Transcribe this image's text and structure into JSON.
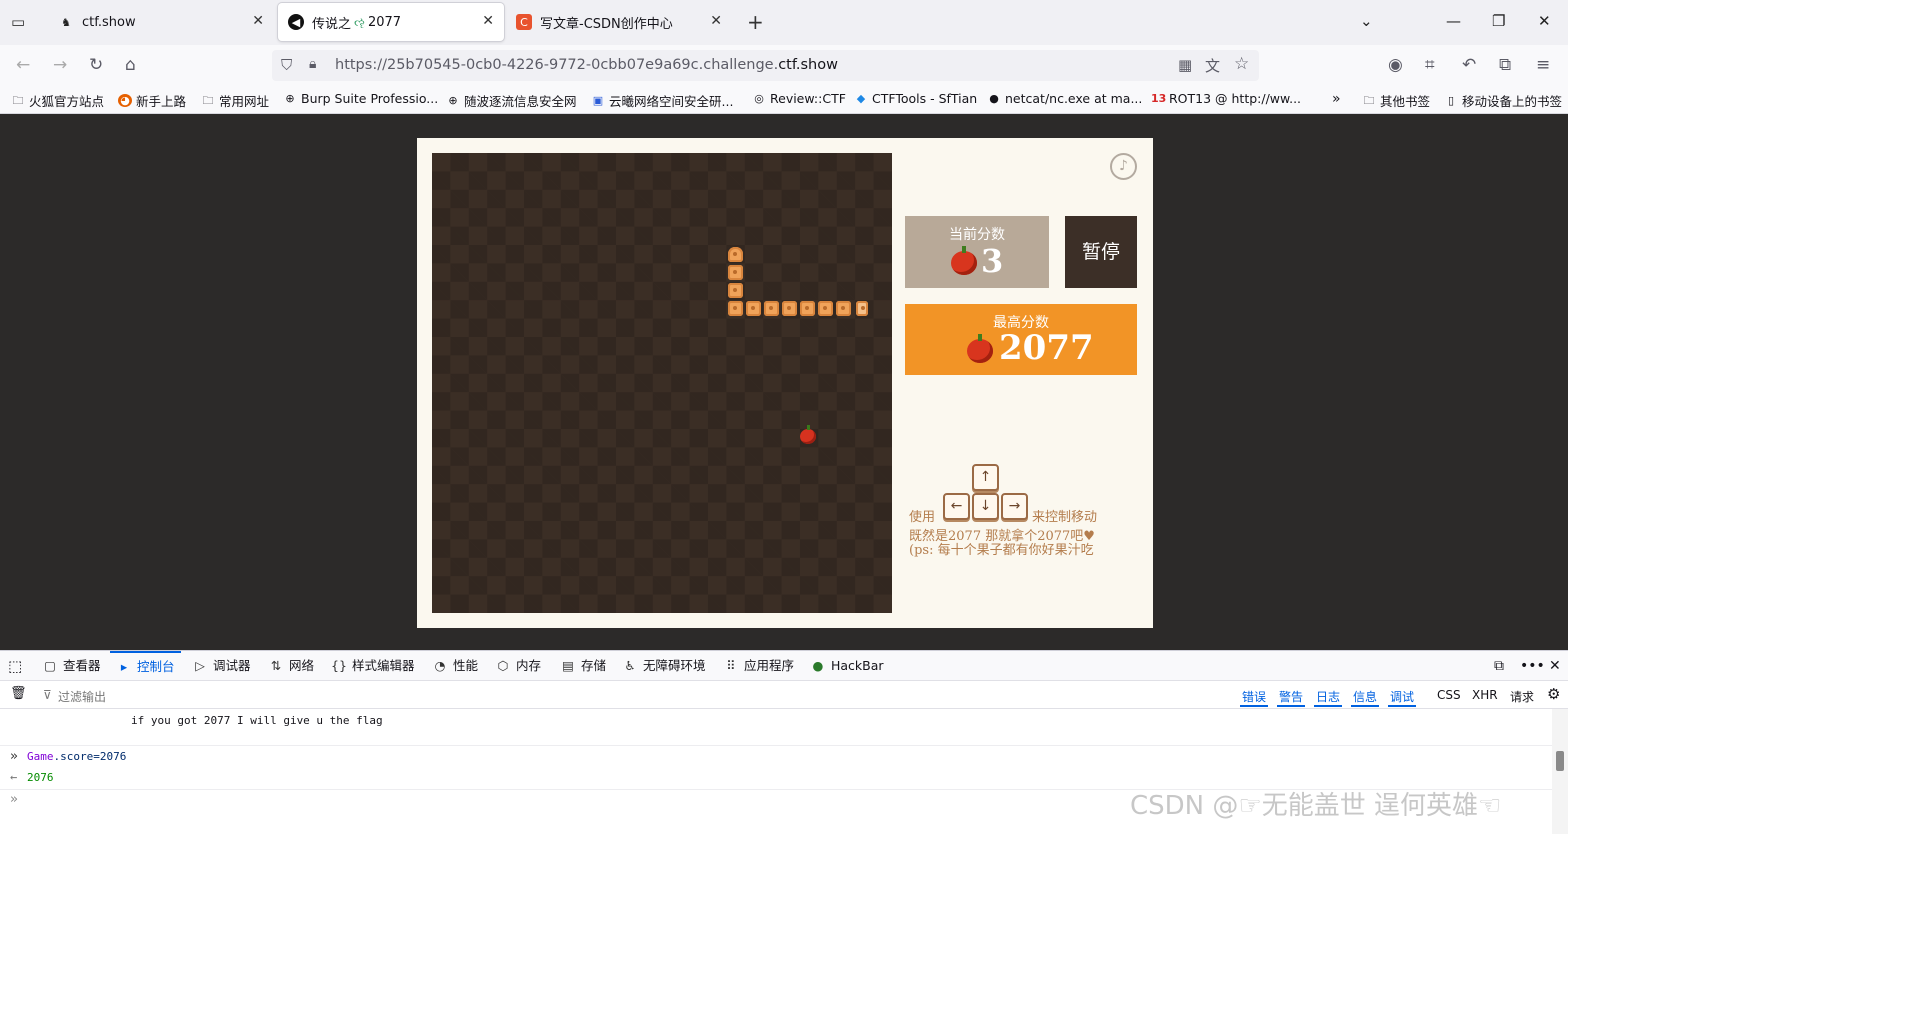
{
  "browser": {
    "tabs": [
      {
        "title": "ctf.show",
        "icon": "ctfshow-icon"
      },
      {
        "title": "传说之",
        "title_suffix": "2077",
        "icon": "audio-playing-icon"
      },
      {
        "title": "写文章-CSDN创作中心",
        "icon": "csdn-icon"
      }
    ],
    "url_prefix": "https://25b70545-0cb0-4226-9772-0cbb07e9a69c.challenge.",
    "url_domain": "ctf.show",
    "bookmarks": [
      "火狐官方站点",
      "新手上路",
      "常用网址",
      "Burp Suite Professio...",
      "随波逐流信息安全网",
      "云曦网络空间安全研...",
      "Review::CTF",
      "CTFTools - SfTian",
      "netcat/nc.exe at ma...",
      "ROT13 @ http://ww..."
    ],
    "bookmarks_right": [
      "其他书签",
      "移动设备上的书签"
    ]
  },
  "game": {
    "current_label": "当前分数",
    "current_score": "3",
    "pause_label": "暂停",
    "best_label": "最高分数",
    "best_score": "2077",
    "help_use": "使用",
    "help_move": "来控制移动",
    "help_line2": "既然是2077 那就拿个2077吧♥",
    "help_line3": "(ps: 每十个果子都有你好果汁吃",
    "keys": {
      "up": "↑",
      "left": "←",
      "down": "↓",
      "right": "→"
    }
  },
  "devtools": {
    "tabs": [
      "查看器",
      "控制台",
      "调试器",
      "网络",
      "样式编辑器",
      "性能",
      "内存",
      "存储",
      "无障碍环境",
      "应用程序",
      "HackBar"
    ],
    "active_tab": "控制台",
    "filter_placeholder": "过滤输出",
    "levels": [
      "错误",
      "警告",
      "日志",
      "信息",
      "调试"
    ],
    "extra_filters": [
      "CSS",
      "XHR",
      "请求"
    ],
    "console": {
      "log_line": "if you got 2077 I will give u the flag",
      "input_obj": "Game",
      "input_rest": ".score=2076",
      "result": "2076"
    }
  },
  "watermark": "CSDN @☞无能盖世 逞何英雄☜"
}
